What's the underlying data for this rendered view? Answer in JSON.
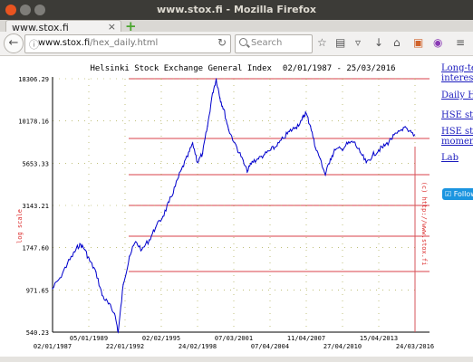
{
  "window": {
    "title": "www.stox.fi - Mozilla Firefox"
  },
  "tab": {
    "title": "www.stox.fi",
    "close": "×",
    "new_tab": "+"
  },
  "nav": {
    "url_host": "www.stox.fi",
    "url_path": "/hex_daily.html",
    "search_placeholder": "Search"
  },
  "toolbar_icons": [
    "back-icon",
    "reload-icon",
    "bookmark-star-icon",
    "reading-list-icon",
    "pocket-icon",
    "download-icon",
    "home-icon",
    "extension-icon",
    "privacy-icon",
    "menu-icon"
  ],
  "sidebar": {
    "links": [
      "Long-te",
      "interest",
      "Daily H",
      "HSE sto",
      "HSE sto",
      "moment",
      "Lab"
    ],
    "follow": "Follow"
  },
  "chart_data": {
    "type": "line",
    "title": "Helsinki Stock Exchange General Index",
    "date_range": "02/01/1987 - 25/03/2016",
    "ylabel": "log scale",
    "watermark": "(c) http://www.stox.fi",
    "y_ticks": [
      "540.23",
      "971.65",
      "1747.60",
      "3143.21",
      "5653.33",
      "10178.16",
      "18306.29"
    ],
    "x_ticks_top": [
      "05/01/1989",
      "02/02/1995",
      "07/03/2001",
      "11/04/2007",
      "15/04/2013"
    ],
    "x_ticks_bottom": [
      "02/01/1987",
      "22/01/1992",
      "24/02/1998",
      "07/04/2004",
      "27/04/2010",
      "24/03/2016"
    ],
    "x": [
      "1987.0",
      "1987.6",
      "1988.2",
      "1988.8",
      "1989.2",
      "1989.6",
      "1990.0",
      "1990.5",
      "1991.0",
      "1991.5",
      "1992.0",
      "1992.3",
      "1992.7",
      "1993.2",
      "1993.7",
      "1994.2",
      "1994.8",
      "1995.3",
      "1995.9",
      "1996.4",
      "1996.9",
      "1997.4",
      "1997.9",
      "1998.3",
      "1998.7",
      "1999.1",
      "1999.5",
      "1999.9",
      "2000.2",
      "2000.5",
      "2000.8",
      "2001.2",
      "2001.7",
      "2002.2",
      "2002.7",
      "2003.1",
      "2003.6",
      "2004.1",
      "2004.6",
      "2005.1",
      "2005.6",
      "2006.1",
      "2006.6",
      "2007.1",
      "2007.4",
      "2007.8",
      "2008.2",
      "2008.6",
      "2009.0",
      "2009.4",
      "2009.8",
      "2010.3",
      "2010.8",
      "2011.3",
      "2011.8",
      "2012.3",
      "2012.8",
      "2013.3",
      "2013.8",
      "2014.3",
      "2014.8",
      "2015.3",
      "2015.7",
      "2016.2"
    ],
    "y": [
      990,
      1150,
      1400,
      1650,
      1850,
      1700,
      1450,
      1250,
      900,
      800,
      700,
      540,
      1050,
      1550,
      1900,
      1700,
      1950,
      2300,
      2700,
      3300,
      4100,
      5200,
      6200,
      7500,
      5700,
      6500,
      9500,
      15000,
      18300,
      14000,
      12000,
      9000,
      7500,
      6200,
      5000,
      5800,
      6000,
      6400,
      6800,
      7200,
      8000,
      8800,
      9300,
      10300,
      11500,
      9500,
      7000,
      6000,
      4800,
      6000,
      6800,
      6900,
      7400,
      7600,
      6600,
      5700,
      6300,
      6800,
      7200,
      7900,
      8600,
      9300,
      8800,
      8400
    ],
    "ylim": [
      540.23,
      18306.29
    ],
    "scale": "log",
    "grid": "dotted"
  }
}
